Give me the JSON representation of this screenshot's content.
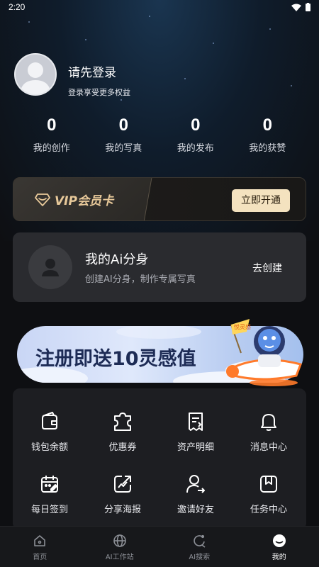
{
  "status_bar": {
    "time": "2:20"
  },
  "profile": {
    "title": "请先登录",
    "subtitle": "登录享受更多权益"
  },
  "stats": [
    {
      "value": "0",
      "label": "我的创作"
    },
    {
      "value": "0",
      "label": "我的写真"
    },
    {
      "value": "0",
      "label": "我的发布"
    },
    {
      "value": "0",
      "label": "我的获赞"
    }
  ],
  "vip": {
    "label": "VIP会员卡",
    "button": "立即开通",
    "accent": "#e8c99a"
  },
  "ai_card": {
    "title": "我的Ai分身",
    "subtitle": "创建AI分身，制作专属写真",
    "action": "去创建"
  },
  "banner": {
    "text": "注册即送10灵感值",
    "flag_text": "悦灵感"
  },
  "menu": [
    {
      "icon": "wallet-icon",
      "label": "钱包余额"
    },
    {
      "icon": "coupon-icon",
      "label": "优惠券"
    },
    {
      "icon": "receipt-icon",
      "label": "资产明细"
    },
    {
      "icon": "bell-icon",
      "label": "消息中心"
    },
    {
      "icon": "calendar-check-icon",
      "label": "每日签到"
    },
    {
      "icon": "share-icon",
      "label": "分享海报"
    },
    {
      "icon": "invite-user-icon",
      "label": "邀请好友"
    },
    {
      "icon": "bookmark-icon",
      "label": "任务中心"
    }
  ],
  "tabbar": [
    {
      "icon": "home-icon",
      "label": "首页"
    },
    {
      "icon": "globe-icon",
      "label": "AI工作站"
    },
    {
      "icon": "ai-search-icon",
      "label": "AI搜索"
    },
    {
      "icon": "profile-face-icon",
      "label": "我的",
      "active": true
    }
  ]
}
